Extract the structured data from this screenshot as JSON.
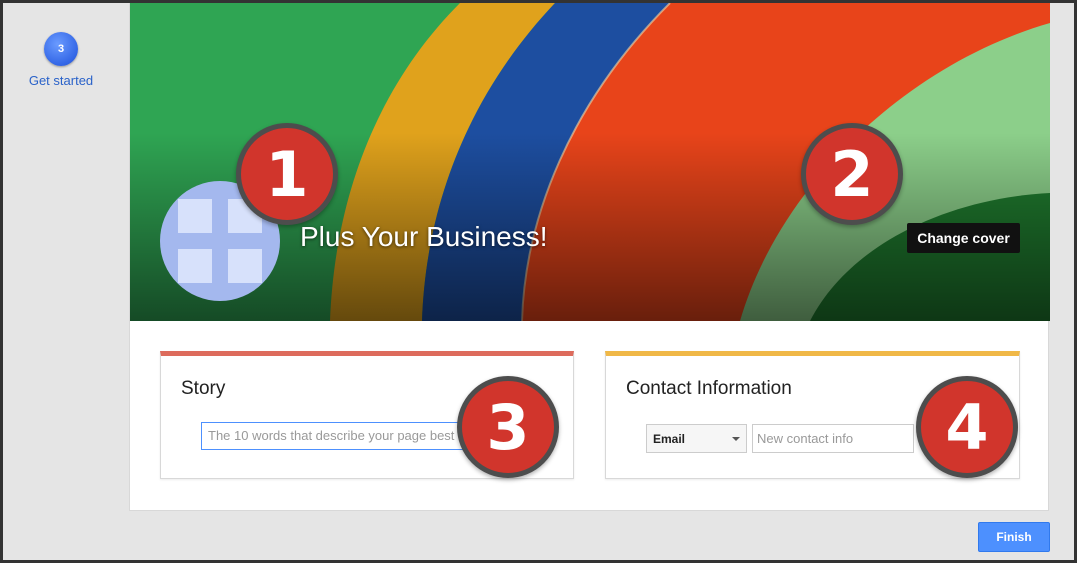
{
  "steps": {
    "current_number": "3",
    "current_label": "Get started"
  },
  "cover": {
    "page_name": "Plus Your Business!",
    "change_cover_label": "Change cover"
  },
  "callouts": [
    "1",
    "2",
    "3",
    "4"
  ],
  "story": {
    "title": "Story",
    "placeholder": "The 10 words that describe your page best"
  },
  "contact": {
    "title": "Contact Information",
    "type_selected": "Email",
    "placeholder": "New contact info"
  },
  "actions": {
    "finish_label": "Finish"
  },
  "colors": {
    "accent_blue": "#4d90fe",
    "callout_red": "#d1352c",
    "story_bar": "#dd6b5c",
    "contact_bar": "#f0b847"
  },
  "icons": {
    "avatar": "default-page-avatar-icon",
    "select_caret": "caret-down-icon"
  }
}
